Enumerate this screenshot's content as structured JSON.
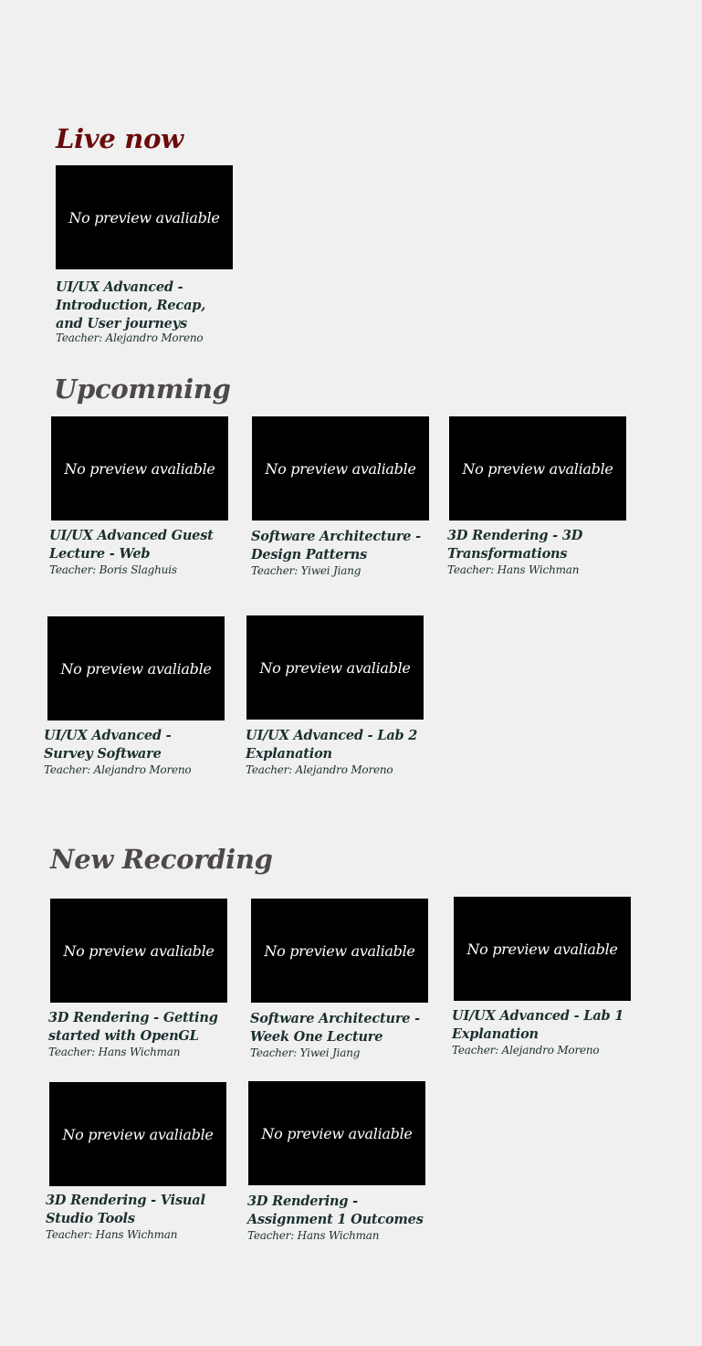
{
  "sections": {
    "live": {
      "title": "Live now",
      "items": [
        {
          "preview_text": "No preview avaliable",
          "title": "UI/UX Advanced - Introduction, Recap, and User journeys",
          "teacher": "Teacher: Alejandro Moreno"
        }
      ]
    },
    "upcoming": {
      "title": "Upcomming",
      "items": [
        {
          "preview_text": "No preview avaliable",
          "title": "UI/UX Advanced Guest Lecture - Web",
          "teacher": "Teacher: Boris Slaghuis"
        },
        {
          "preview_text": "No preview avaliable",
          "title": "Software Architecture - Design Patterns",
          "teacher": "Teacher: Yiwei Jiang"
        },
        {
          "preview_text": "No preview avaliable",
          "title": "3D Rendering - 3D Transformations",
          "teacher": "Teacher: Hans Wichman"
        },
        {
          "preview_text": "No preview avaliable",
          "title": "UI/UX Advanced - Survey Software",
          "teacher": "Teacher: Alejandro Moreno"
        },
        {
          "preview_text": "No preview avaliable",
          "title": "UI/UX Advanced - Lab 2 Explanation",
          "teacher": "Teacher: Alejandro Moreno"
        }
      ]
    },
    "new_recording": {
      "title": "New Recording",
      "items": [
        {
          "preview_text": "No preview avaliable",
          "title": "3D Rendering - Getting started with OpenGL",
          "teacher": "Teacher: Hans Wichman"
        },
        {
          "preview_text": "No preview avaliable",
          "title": "Software Architecture - Week One Lecture",
          "teacher": "Teacher: Yiwei Jiang"
        },
        {
          "preview_text": "No preview avaliable",
          "title": "UI/UX Advanced - Lab 1 Explanation",
          "teacher": "Teacher: Alejandro Moreno"
        },
        {
          "preview_text": "No preview avaliable",
          "title": "3D Rendering - Visual Studio Tools",
          "teacher": "Teacher: Hans Wichman"
        },
        {
          "preview_text": "No preview avaliable",
          "title": "3D Rendering - Assignment 1 Outcomes",
          "teacher": "Teacher: Hans Wichman"
        }
      ]
    }
  },
  "colors": {
    "background": "#f0f0f0",
    "live_title": "#6b0a0a",
    "section_title": "#4d4849",
    "card_text": "#1b302e",
    "thumbnail": "#000000",
    "thumbnail_text": "#ffffff"
  }
}
